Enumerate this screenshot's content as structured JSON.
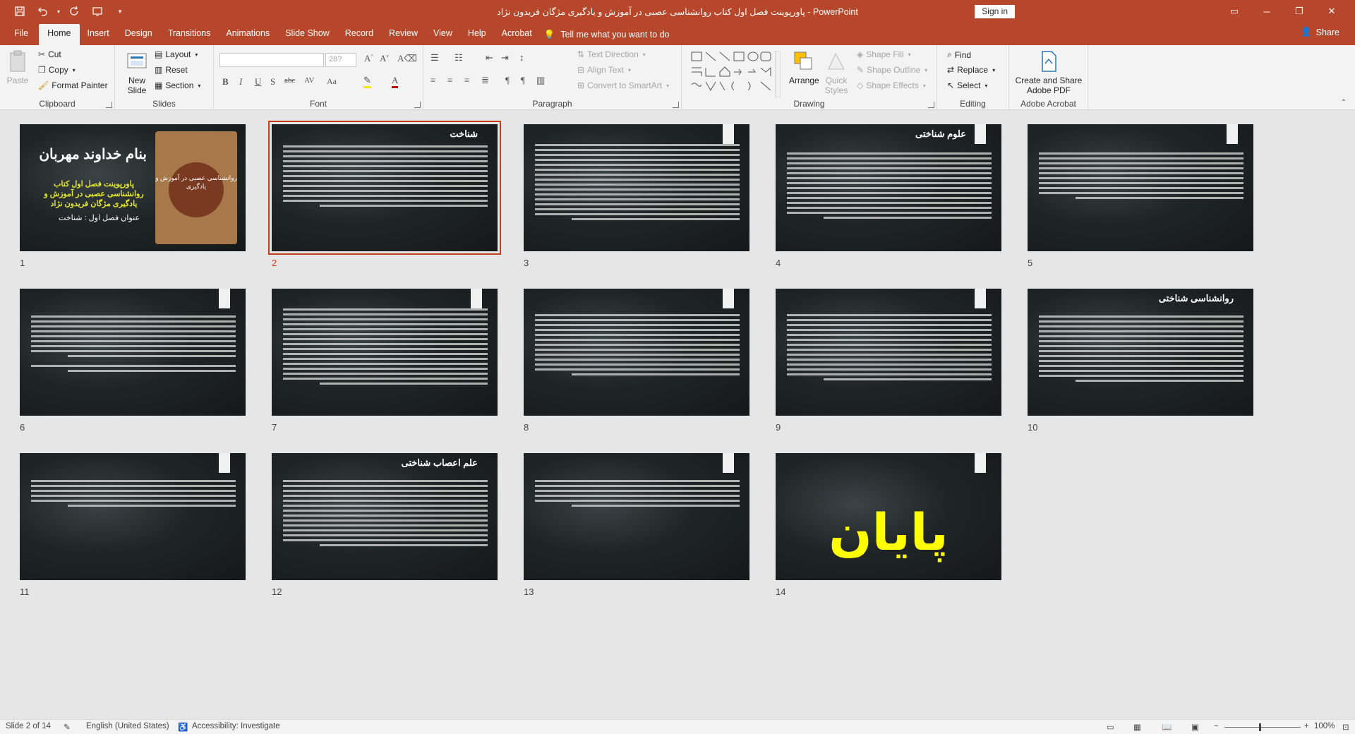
{
  "window": {
    "title": "پاورپوینت فصل اول کتاب روانشناسی عصبی در آموزش و یادگیری مژگان فریدون نژاد  -  PowerPoint",
    "signin": "Sign in"
  },
  "tabs": [
    "File",
    "Home",
    "Insert",
    "Design",
    "Transitions",
    "Animations",
    "Slide Show",
    "Record",
    "Review",
    "View",
    "Help",
    "Acrobat"
  ],
  "tellme": "Tell me what you want to do",
  "share": "Share",
  "ribbon": {
    "clipboard": {
      "label": "Clipboard",
      "paste": "Paste",
      "cut": "Cut",
      "copy": "Copy",
      "format_painter": "Format Painter"
    },
    "slides": {
      "label": "Slides",
      "new_slide_1": "New",
      "new_slide_2": "Slide",
      "layout": "Layout",
      "reset": "Reset",
      "section": "Section"
    },
    "font": {
      "label": "Font",
      "size": "28?",
      "bold": "B",
      "italic": "I",
      "underline": "U",
      "strike": "S",
      "shadow": "abc",
      "spacing": "AV",
      "case": "Aa"
    },
    "paragraph": {
      "label": "Paragraph",
      "text_direction": "Text Direction",
      "align_text": "Align Text",
      "smartart": "Convert to SmartArt"
    },
    "drawing": {
      "label": "Drawing",
      "arrange": "Arrange",
      "quick_styles_1": "Quick",
      "quick_styles_2": "Styles",
      "shape_fill": "Shape Fill",
      "shape_outline": "Shape Outline",
      "shape_effects": "Shape Effects"
    },
    "editing": {
      "label": "Editing",
      "find": "Find",
      "replace": "Replace",
      "select": "Select"
    },
    "acrobat": {
      "label": "Adobe Acrobat",
      "create_1": "Create and Share",
      "create_2": "Adobe PDF"
    }
  },
  "slides": [
    {
      "num": "1",
      "title": "بنام خداوند مهربان",
      "subtitle": "پاورپوینت فصل اول کتاب روانشناسی عصبی در آموزش و یادگیری مژگان فریدون نژاد",
      "subtitle2": "عنوان فصل اول : شناخت",
      "book_title": "روانشناسی عصبی در آموزش و یادگیری"
    },
    {
      "num": "2",
      "title": "شناخت"
    },
    {
      "num": "3",
      "title": ""
    },
    {
      "num": "4",
      "title": "علوم شناختی"
    },
    {
      "num": "5",
      "title": ""
    },
    {
      "num": "6",
      "title": ""
    },
    {
      "num": "7",
      "title": ""
    },
    {
      "num": "8",
      "title": ""
    },
    {
      "num": "9",
      "title": ""
    },
    {
      "num": "10",
      "title": "روانشناسی شناختی"
    },
    {
      "num": "11",
      "title": ""
    },
    {
      "num": "12",
      "title": "علم اعصاب شناختی"
    },
    {
      "num": "13",
      "title": ""
    },
    {
      "num": "14",
      "title": "پایان"
    }
  ],
  "status": {
    "slide": "Slide 2 of 14",
    "language": "English (United States)",
    "accessibility": "Accessibility: Investigate",
    "zoom": "100%"
  }
}
